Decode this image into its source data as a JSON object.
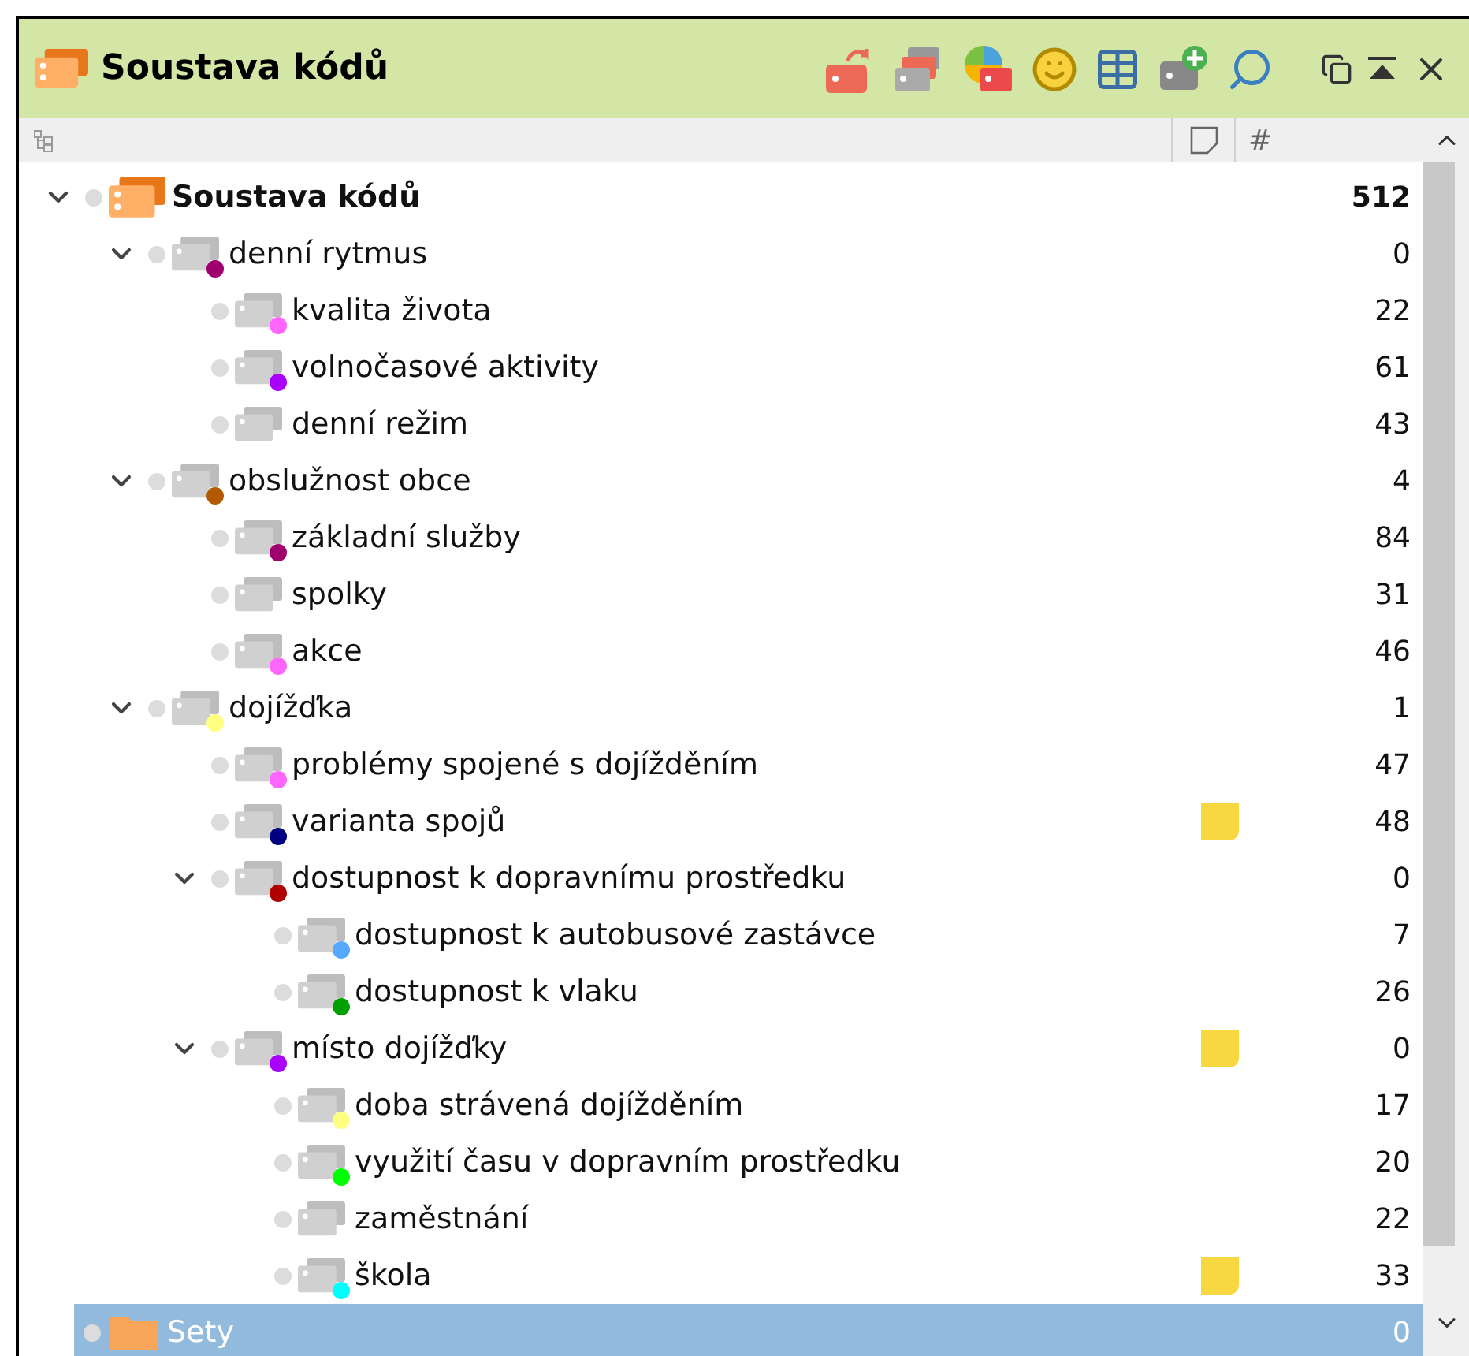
{
  "window": {
    "title": "Soustava kódů"
  },
  "header": {
    "count_column": "#"
  },
  "tree": [
    {
      "kind": "root",
      "label": "Soustava kódů",
      "count": "512",
      "selected": false,
      "expanded": true,
      "memo": false,
      "children": [
        {
          "kind": "code",
          "label": "denní rytmus",
          "count": "0",
          "color": "#a0006e",
          "selected": false,
          "expanded": true,
          "memo": false,
          "children": [
            {
              "kind": "code",
              "label": "kvalita života",
              "count": "22",
              "color": "#ff66ff",
              "selected": false,
              "memo": false
            },
            {
              "kind": "code",
              "label": "volnočasové aktivity",
              "count": "61",
              "color": "#aa00ff",
              "selected": false,
              "memo": false
            },
            {
              "kind": "code",
              "label": "denní režim",
              "count": "43",
              "selected": false,
              "memo": false
            }
          ]
        },
        {
          "kind": "code",
          "label": "obslužnost obce",
          "count": "4",
          "color": "#b35900",
          "selected": false,
          "expanded": true,
          "memo": false,
          "children": [
            {
              "kind": "code",
              "label": "základní služby",
              "count": "84",
              "color": "#a0006e",
              "selected": false,
              "memo": false
            },
            {
              "kind": "code",
              "label": "spolky",
              "count": "31",
              "selected": false,
              "memo": false
            },
            {
              "kind": "code",
              "label": "akce",
              "count": "46",
              "color": "#ff66ff",
              "selected": false,
              "memo": false
            }
          ]
        },
        {
          "kind": "code",
          "label": "dojížďka",
          "count": "1",
          "color": "#ffff80",
          "selected": false,
          "expanded": true,
          "memo": false,
          "children": [
            {
              "kind": "code",
              "label": "problémy spojené s dojížděním",
              "count": "47",
              "color": "#ff66ff",
              "selected": false,
              "memo": false
            },
            {
              "kind": "code",
              "label": "varianta spojů",
              "count": "48",
              "color": "#000080",
              "selected": false,
              "memo": true
            },
            {
              "kind": "code",
              "label": "dostupnost k dopravnímu prostředku",
              "count": "0",
              "color": "#b00000",
              "selected": false,
              "expanded": true,
              "memo": false,
              "children": [
                {
                  "kind": "code",
                  "label": "dostupnost k autobusové zastávce",
                  "count": "7",
                  "color": "#55aaff",
                  "selected": false,
                  "memo": false
                },
                {
                  "kind": "code",
                  "label": "dostupnost k vlaku",
                  "count": "26",
                  "color": "#00a000",
                  "selected": false,
                  "memo": false
                }
              ]
            },
            {
              "kind": "code",
              "label": "místo dojížďky",
              "count": "0",
              "color": "#aa00ff",
              "selected": false,
              "expanded": true,
              "memo": true,
              "children": [
                {
                  "kind": "code",
                  "label": "doba strávená dojížděním",
                  "count": "17",
                  "color": "#ffff80",
                  "selected": false,
                  "memo": false
                },
                {
                  "kind": "code",
                  "label": "využití času v dopravním prostředku",
                  "count": "20",
                  "color": "#00ff00",
                  "selected": false,
                  "memo": false
                },
                {
                  "kind": "code",
                  "label": "zaměstnání",
                  "count": "22",
                  "selected": false,
                  "memo": false
                },
                {
                  "kind": "code",
                  "label": "škola",
                  "count": "33",
                  "color": "#00ffff",
                  "selected": false,
                  "memo": true
                }
              ]
            }
          ]
        }
      ]
    },
    {
      "kind": "set",
      "label": "Sety",
      "count": "0",
      "selected": true,
      "memo": false
    }
  ]
}
